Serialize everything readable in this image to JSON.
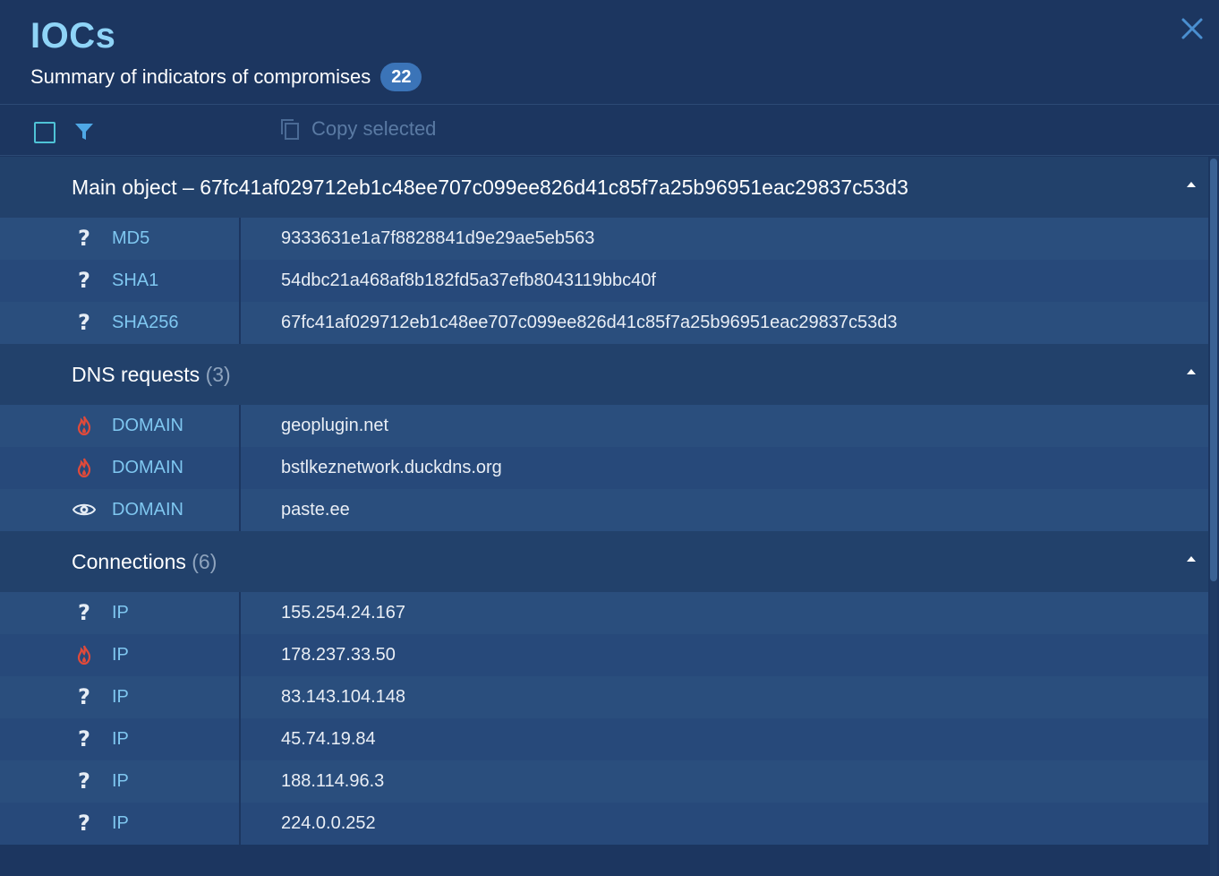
{
  "header": {
    "title": "IOCs",
    "subtitle": "Summary of indicators of compromises",
    "count_badge": "22"
  },
  "toolbar": {
    "copy_label": "Copy selected"
  },
  "sections": {
    "main": {
      "title": "Main object – 67fc41af029712eb1c48ee707c099ee826d41c85f7a25b96951eac29837c53d3",
      "rows": [
        {
          "icon": "question-icon",
          "type": "MD5",
          "value": "9333631e1a7f8828841d9e29ae5eb563"
        },
        {
          "icon": "question-icon",
          "type": "SHA1",
          "value": "54dbc21a468af8b182fd5a37efb8043119bbc40f"
        },
        {
          "icon": "question-icon",
          "type": "SHA256",
          "value": "67fc41af029712eb1c48ee707c099ee826d41c85f7a25b96951eac29837c53d3"
        }
      ]
    },
    "dns": {
      "title": "DNS requests",
      "count": "(3)",
      "rows": [
        {
          "icon": "fire-icon",
          "type": "DOMAIN",
          "value": "geoplugin.net"
        },
        {
          "icon": "fire-icon",
          "type": "DOMAIN",
          "value": "bstlkeznetwork.duckdns.org"
        },
        {
          "icon": "eye-icon",
          "type": "DOMAIN",
          "value": "paste.ee"
        }
      ]
    },
    "connections": {
      "title": "Connections",
      "count": "(6)",
      "rows": [
        {
          "icon": "question-icon",
          "type": "IP",
          "value": "155.254.24.167"
        },
        {
          "icon": "fire-icon",
          "type": "IP",
          "value": "178.237.33.50"
        },
        {
          "icon": "question-icon",
          "type": "IP",
          "value": "83.143.104.148"
        },
        {
          "icon": "question-icon",
          "type": "IP",
          "value": "45.74.19.84"
        },
        {
          "icon": "question-icon",
          "type": "IP",
          "value": "188.114.96.3"
        },
        {
          "icon": "question-icon",
          "type": "IP",
          "value": "224.0.0.252"
        }
      ]
    }
  },
  "colors": {
    "background": "#1c3660",
    "title": "#8fd4f7",
    "accent": "#3b74b8",
    "type_text": "#7fc7f0",
    "malicious": "#e04a3a",
    "checkbox": "#4fc3d6"
  }
}
